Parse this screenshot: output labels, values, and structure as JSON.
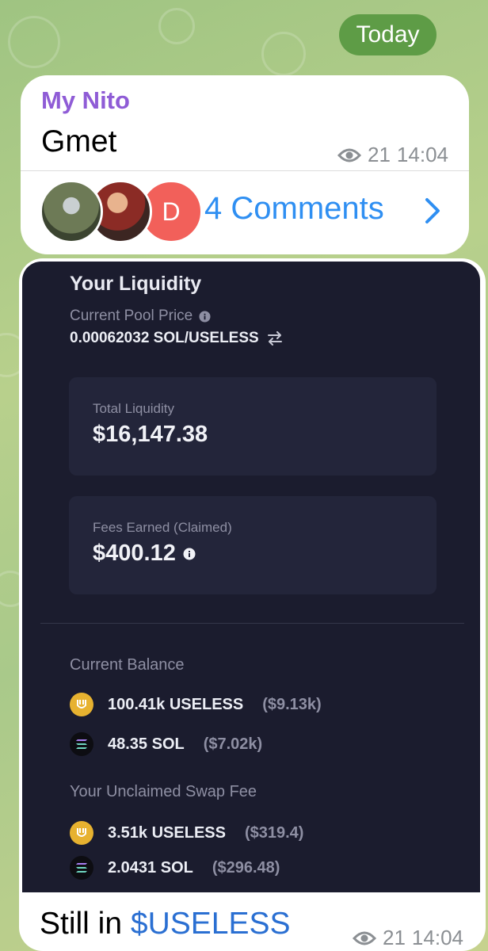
{
  "date_pill": "Today",
  "post1": {
    "sender": "My Nito",
    "text": "Gmet",
    "views": "21",
    "time": "14:04"
  },
  "comments": {
    "label": "4 Comments",
    "avatar3_letter": "D"
  },
  "screenshot": {
    "title": "Your Liquidity",
    "pool_price_label": "Current Pool Price",
    "pool_price_value": "0.00062032 SOL/USELESS",
    "total_liquidity_label": "Total Liquidity",
    "total_liquidity_value": "$16,147.38",
    "fees_label": "Fees Earned (Claimed)",
    "fees_value": "$400.12",
    "balance_label": "Current Balance",
    "balance": [
      {
        "icon": "useless-token-icon",
        "amount": "100.41k USELESS",
        "usd": "($9.13k)"
      },
      {
        "icon": "sol-token-icon",
        "amount": "48.35 SOL",
        "usd": "($7.02k)"
      }
    ],
    "unclaimed_label": "Your Unclaimed Swap Fee",
    "unclaimed": [
      {
        "icon": "useless-token-icon",
        "amount": "3.51k USELESS",
        "usd": "($319.4)"
      },
      {
        "icon": "sol-token-icon",
        "amount": "2.0431 SOL",
        "usd": "($296.48)"
      }
    ]
  },
  "post2": {
    "text_prefix": "Still in ",
    "cashtag": "$USELESS",
    "views": "21",
    "time": "14:04"
  },
  "colors": {
    "accent_link": "#2f8ff2",
    "sender_name": "#8f5cd6",
    "date_pill": "#5e9c46",
    "useless_token": "#e7b230"
  }
}
